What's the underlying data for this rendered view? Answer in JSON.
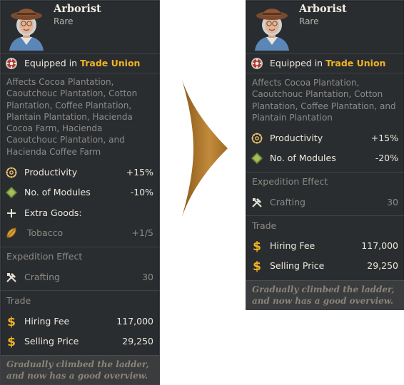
{
  "colors": {
    "panel_bg": "#2a2d30",
    "highlight": "#f0b323",
    "dim_text": "#8e8a83",
    "arrow": "#b07a2a"
  },
  "left": {
    "name": "Arborist",
    "rarity": "Rare",
    "equipped_prefix": "Equipped in",
    "equipped_place": "Trade Union",
    "description_lines": [
      "Affects Cocoa Plantation,",
      "Caoutchouc Plantation, Cotton",
      "Plantation, Coffee Plantation,",
      "Plantain Plantation, Hacienda",
      "Cocoa Farm, Hacienda",
      "Caoutchouc Plantation, and",
      "Hacienda Coffee Farm"
    ],
    "productivity_label": "Productivity",
    "productivity_value": "+15%",
    "modules_label": "No. of Modules",
    "modules_value": "-10%",
    "extra_goods_label": "Extra Goods:",
    "tobacco_label": "Tobacco",
    "tobacco_value": "+1/5",
    "expedition_header": "Expedition Effect",
    "crafting_label": "Crafting",
    "crafting_value": "30",
    "trade_header": "Trade",
    "hiring_label": "Hiring Fee",
    "hiring_value": "117,000",
    "selling_label": "Selling Price",
    "selling_value": "29,250",
    "flavor_lines": [
      "Gradually climbed the ladder,",
      "and now has a good overview."
    ]
  },
  "right": {
    "name": "Arborist",
    "rarity": "Rare",
    "equipped_prefix": "Equipped in",
    "equipped_place": "Trade Union",
    "description_lines": [
      "Affects Cocoa Plantation,",
      "Caoutchouc Plantation, Cotton",
      "Plantation, Coffee Plantation, and",
      "Plantain Plantation"
    ],
    "productivity_label": "Productivity",
    "productivity_value": "+15%",
    "modules_label": "No. of Modules",
    "modules_value": "-20%",
    "expedition_header": "Expedition Effect",
    "crafting_label": "Crafting",
    "crafting_value": "30",
    "trade_header": "Trade",
    "hiring_label": "Hiring Fee",
    "hiring_value": "117,000",
    "selling_label": "Selling Price",
    "selling_value": "29,250",
    "flavor_lines": [
      "Gradually climbed the ladder,",
      "and now has a good overview."
    ]
  },
  "icons": {
    "portrait": "arborist-portrait",
    "equipped": "trade-union-icon",
    "productivity": "productivity-gear-icon",
    "modules": "modules-leaf-icon",
    "extra_goods": "plus-icon",
    "tobacco": "tobacco-leaf-icon",
    "crafting": "crafting-tools-icon",
    "money": "dollar-icon",
    "arrow": "right-arrow-icon"
  }
}
